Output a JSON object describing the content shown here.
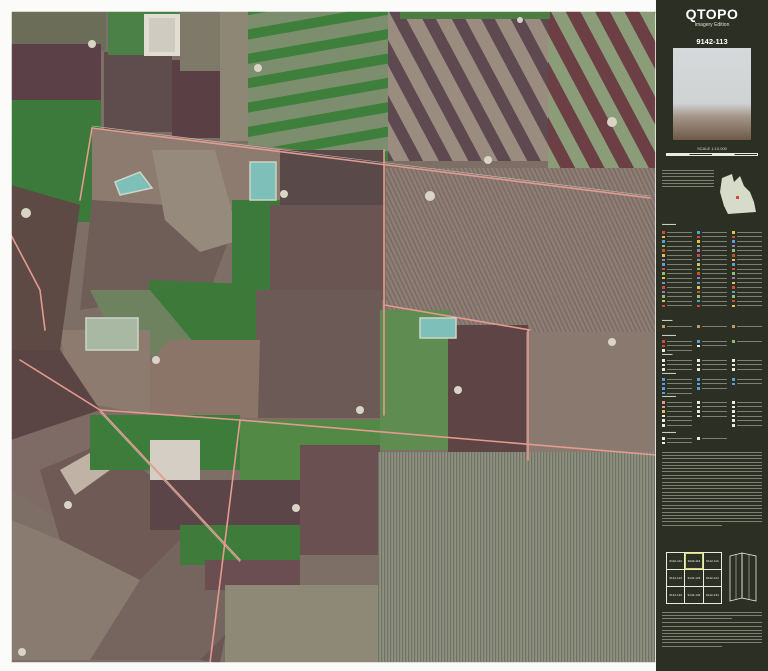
{
  "product": {
    "brand": "QTOPO",
    "edition": "Imagery Edition",
    "sheet_number": "9142-113",
    "scale_label": "SCALE 1:10,000"
  },
  "index_map": {
    "cells": [
      "9142-112",
      "9142-113",
      "9142-114",
      "9142-122",
      "9142-123",
      "9142-124",
      "9142-132",
      "9142-133",
      "9142-134"
    ],
    "selected": "9142-113"
  },
  "colors": {
    "panel_bg": "#2b2f24",
    "panel_text": "#e9ecde",
    "road": "#e49a8e",
    "water": "#7fbfba",
    "crop_green": "#3d7a3a",
    "soil_brown": "#5d4a44",
    "fallow": "#8a7c72"
  },
  "icons": [
    "queensland-outline-icon",
    "photo-thumbnail",
    "scale-bar",
    "index-map-grid",
    "fold-diagram-icon"
  ]
}
